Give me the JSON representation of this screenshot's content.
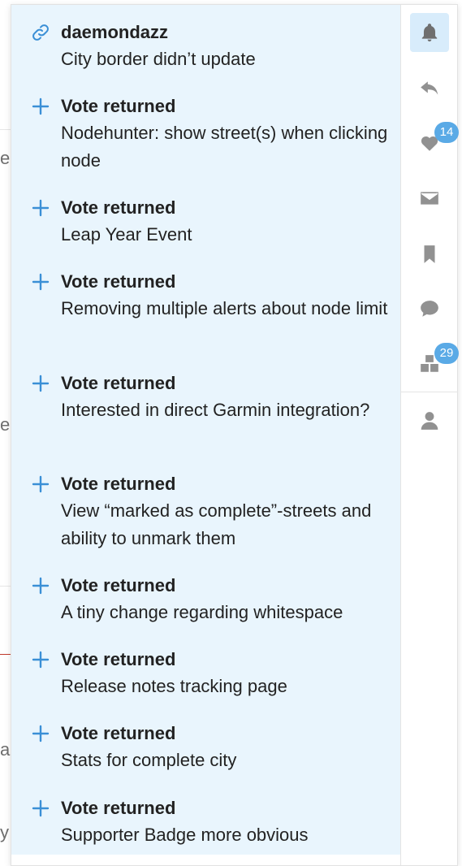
{
  "notifications": [
    {
      "icon": "link-icon",
      "title": "daemondazz",
      "body": "City border didn’t update"
    },
    {
      "icon": "plus-icon",
      "title": "Vote returned",
      "body": "Nodehunter: show street(s) when clicking node"
    },
    {
      "icon": "plus-icon",
      "title": "Vote returned",
      "body": "Leap Year Event"
    },
    {
      "icon": "plus-icon",
      "title": "Vote returned",
      "body": "Removing multiple alerts about node limit"
    },
    {
      "icon": "plus-icon",
      "title": "Vote returned",
      "body": "Interested in direct Garmin integration?"
    },
    {
      "icon": "plus-icon",
      "title": "Vote returned",
      "body": "View “marked as complete”-streets and ability to unmark them"
    },
    {
      "icon": "plus-icon",
      "title": "Vote returned",
      "body": "A tiny change regarding whitespace"
    },
    {
      "icon": "plus-icon",
      "title": "Vote returned",
      "body": "Release notes tracking page"
    },
    {
      "icon": "plus-icon",
      "title": "Vote returned",
      "body": "Stats for complete city"
    },
    {
      "icon": "plus-icon",
      "title": "Vote returned",
      "body": "Supporter Badge more obvious"
    }
  ],
  "rail": {
    "items": [
      {
        "icon": "bell-icon",
        "active": true
      },
      {
        "icon": "reply-icon"
      },
      {
        "icon": "heart-icon",
        "badge": "14"
      },
      {
        "icon": "mail-icon"
      },
      {
        "icon": "bookmark-icon"
      },
      {
        "icon": "chat-icon"
      },
      {
        "icon": "badges-icon",
        "badge": "29"
      },
      {
        "icon": "user-icon"
      }
    ]
  },
  "background_fragments": [
    "e",
    "er",
    "a",
    "y"
  ],
  "colors": {
    "accent": "#3a8fd6",
    "unread_bg": "#e9f5fd",
    "active_rail_bg": "#d8ecfb",
    "badge_bg": "#5aaae6"
  }
}
